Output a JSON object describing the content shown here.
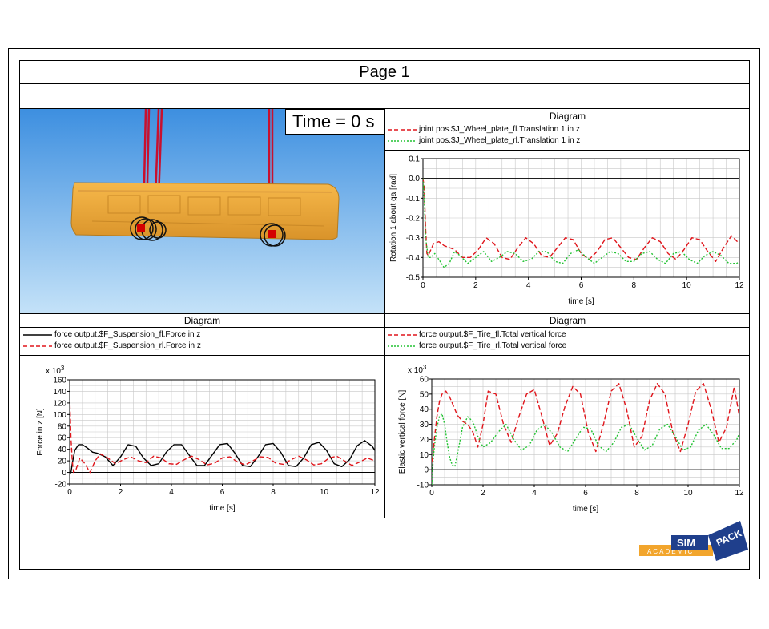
{
  "page": {
    "title": "Page 1"
  },
  "animation": {
    "time_label": "Time = 0 s"
  },
  "logo": {
    "text_top": "SIM",
    "text_right": "PACK",
    "text_bottom": "ACADEMIC"
  },
  "colors": {
    "red": "#e0151b",
    "green": "#22c232",
    "black": "#000000",
    "grid": "#c8c8c8",
    "body": "#f2a52c",
    "sky_top": "#3d8fe0",
    "sky_bottom": "#c4e2f8"
  },
  "chart_data": [
    {
      "id": "chart_rotation",
      "type": "line",
      "panel_title": "Diagram",
      "xlabel": "time [s]",
      "ylabel": "Rotation 1 about ga [rad]",
      "xlim": [
        0,
        12
      ],
      "ylim": [
        -0.5,
        0.1
      ],
      "xticks": [
        0,
        2,
        4,
        6,
        8,
        10,
        12
      ],
      "yticks": [
        -0.5,
        -0.4,
        -0.3,
        -0.2,
        -0.1,
        0.0,
        0.1
      ],
      "ytick_labels": [
        "-0.5",
        "-0.4",
        "-0.3",
        "-0.2",
        "-0.1",
        "0.0",
        "0.1"
      ],
      "multiplier": "",
      "series": [
        {
          "name": "joint pos.$J_Wheel_plate_fl.Translation 1 in z",
          "color": "#e0151b",
          "style": "dashed",
          "x": [
            0,
            0.05,
            0.1,
            0.15,
            0.2,
            0.3,
            0.4,
            0.6,
            0.8,
            1.0,
            1.2,
            1.5,
            1.8,
            2.1,
            2.4,
            2.7,
            3.0,
            3.3,
            3.6,
            3.9,
            4.2,
            4.5,
            4.8,
            5.1,
            5.4,
            5.7,
            6.0,
            6.3,
            6.6,
            6.9,
            7.2,
            7.5,
            7.8,
            8.1,
            8.4,
            8.7,
            9.0,
            9.3,
            9.6,
            9.9,
            10.2,
            10.5,
            10.8,
            11.1,
            11.4,
            11.7,
            12.0
          ],
          "y": [
            0.0,
            -0.05,
            -0.25,
            -0.38,
            -0.39,
            -0.36,
            -0.33,
            -0.32,
            -0.34,
            -0.35,
            -0.36,
            -0.4,
            -0.4,
            -0.36,
            -0.3,
            -0.33,
            -0.4,
            -0.41,
            -0.35,
            -0.3,
            -0.33,
            -0.39,
            -0.4,
            -0.35,
            -0.3,
            -0.31,
            -0.38,
            -0.41,
            -0.37,
            -0.31,
            -0.3,
            -0.35,
            -0.4,
            -0.41,
            -0.35,
            -0.3,
            -0.32,
            -0.38,
            -0.41,
            -0.36,
            -0.3,
            -0.31,
            -0.37,
            -0.42,
            -0.35,
            -0.29,
            -0.33
          ]
        },
        {
          "name": "joint pos.$J_Wheel_plate_rl.Translation 1 in z",
          "color": "#22c232",
          "style": "dotted",
          "x": [
            0,
            0.05,
            0.1,
            0.2,
            0.3,
            0.45,
            0.6,
            0.8,
            1.0,
            1.2,
            1.4,
            1.7,
            2.0,
            2.3,
            2.6,
            2.9,
            3.2,
            3.5,
            3.8,
            4.1,
            4.4,
            4.7,
            5.0,
            5.3,
            5.6,
            5.9,
            6.2,
            6.5,
            6.8,
            7.1,
            7.4,
            7.7,
            8.0,
            8.3,
            8.6,
            8.9,
            9.2,
            9.5,
            9.8,
            10.1,
            10.4,
            10.7,
            11.0,
            11.3,
            11.6,
            11.9,
            12.0
          ],
          "y": [
            0.0,
            -0.1,
            -0.3,
            -0.4,
            -0.4,
            -0.38,
            -0.41,
            -0.45,
            -0.43,
            -0.37,
            -0.39,
            -0.43,
            -0.4,
            -0.37,
            -0.42,
            -0.4,
            -0.37,
            -0.38,
            -0.42,
            -0.41,
            -0.37,
            -0.37,
            -0.42,
            -0.43,
            -0.38,
            -0.36,
            -0.4,
            -0.43,
            -0.4,
            -0.37,
            -0.38,
            -0.42,
            -0.42,
            -0.38,
            -0.37,
            -0.41,
            -0.43,
            -0.38,
            -0.37,
            -0.41,
            -0.43,
            -0.39,
            -0.37,
            -0.39,
            -0.43,
            -0.43,
            -0.42
          ]
        }
      ]
    },
    {
      "id": "chart_suspension",
      "type": "line",
      "panel_title": "Diagram",
      "xlabel": "time [s]",
      "ylabel": "Force in z [N]",
      "xlim": [
        0,
        12
      ],
      "ylim": [
        -20,
        160
      ],
      "xticks": [
        0,
        2,
        4,
        6,
        8,
        10,
        12
      ],
      "yticks": [
        -20,
        0,
        20,
        40,
        60,
        80,
        100,
        120,
        140,
        160
      ],
      "ytick_labels": [
        "-20",
        "0",
        "20",
        "40",
        "60",
        "80",
        "100",
        "120",
        "140",
        "160"
      ],
      "multiplier": "x 10^3",
      "series": [
        {
          "name": "force output.$F_Suspension_fl.Force in z",
          "color": "#000000",
          "style": "solid",
          "x": [
            0,
            0.05,
            0.1,
            0.2,
            0.35,
            0.5,
            0.7,
            0.9,
            1.1,
            1.4,
            1.7,
            2.0,
            2.3,
            2.6,
            2.9,
            3.2,
            3.5,
            3.8,
            4.1,
            4.4,
            4.7,
            5.0,
            5.3,
            5.6,
            5.9,
            6.2,
            6.5,
            6.8,
            7.1,
            7.4,
            7.7,
            8.0,
            8.3,
            8.6,
            8.9,
            9.2,
            9.5,
            9.8,
            10.1,
            10.4,
            10.7,
            11.0,
            11.3,
            11.6,
            11.9,
            12.0
          ],
          "y": [
            -2,
            0,
            15,
            38,
            48,
            48,
            42,
            35,
            33,
            27,
            12,
            27,
            48,
            45,
            25,
            12,
            15,
            35,
            48,
            48,
            30,
            12,
            12,
            30,
            48,
            50,
            33,
            12,
            10,
            27,
            48,
            50,
            35,
            12,
            10,
            25,
            48,
            52,
            38,
            15,
            10,
            22,
            46,
            55,
            45,
            38
          ]
        },
        {
          "name": "force output.$F_Suspension_rl.Force in z",
          "color": "#e0151b",
          "style": "dashed",
          "x": [
            0,
            0.05,
            0.1,
            0.15,
            0.25,
            0.4,
            0.6,
            0.8,
            1.0,
            1.2,
            1.5,
            1.8,
            2.1,
            2.4,
            2.7,
            3.0,
            3.3,
            3.6,
            3.9,
            4.2,
            4.5,
            4.8,
            5.1,
            5.4,
            5.7,
            6.0,
            6.3,
            6.6,
            6.9,
            7.2,
            7.5,
            7.8,
            8.1,
            8.4,
            8.7,
            9.0,
            9.3,
            9.6,
            9.9,
            10.2,
            10.5,
            10.8,
            11.1,
            11.4,
            11.7,
            12.0
          ],
          "y": [
            130,
            60,
            20,
            0,
            5,
            25,
            15,
            0,
            20,
            32,
            25,
            15,
            22,
            27,
            20,
            17,
            28,
            25,
            15,
            14,
            22,
            28,
            22,
            13,
            16,
            25,
            27,
            18,
            13,
            20,
            27,
            26,
            16,
            14,
            22,
            28,
            22,
            13,
            15,
            25,
            28,
            20,
            12,
            18,
            25,
            20
          ]
        }
      ]
    },
    {
      "id": "chart_tire",
      "type": "line",
      "panel_title": "Diagram",
      "xlabel": "time [s]",
      "ylabel": "Elastic vertical force [N]",
      "xlim": [
        0,
        12
      ],
      "ylim": [
        -10,
        60
      ],
      "xticks": [
        0,
        2,
        4,
        6,
        8,
        10,
        12
      ],
      "yticks": [
        -10,
        0,
        10,
        20,
        30,
        40,
        50,
        60
      ],
      "ytick_labels": [
        "-10",
        "0",
        "10",
        "20",
        "30",
        "40",
        "50",
        "60"
      ],
      "multiplier": "x 10^3",
      "series": [
        {
          "name": "force output.$F_Tire_fl.Total vertical force",
          "color": "#e0151b",
          "style": "dashed",
          "x": [
            0,
            0.05,
            0.1,
            0.2,
            0.3,
            0.4,
            0.55,
            0.7,
            0.85,
            1.0,
            1.2,
            1.4,
            1.6,
            1.8,
            2.0,
            2.2,
            2.5,
            2.8,
            3.1,
            3.4,
            3.7,
            4.0,
            4.3,
            4.6,
            4.9,
            5.2,
            5.5,
            5.8,
            6.1,
            6.4,
            6.7,
            7.0,
            7.3,
            7.6,
            7.9,
            8.2,
            8.5,
            8.8,
            9.1,
            9.4,
            9.7,
            10.0,
            10.3,
            10.6,
            10.9,
            11.2,
            11.5,
            11.8,
            12.0
          ],
          "y": [
            5,
            10,
            20,
            35,
            45,
            50,
            52,
            48,
            42,
            36,
            32,
            30,
            25,
            15,
            30,
            52,
            50,
            30,
            18,
            35,
            50,
            53,
            35,
            16,
            24,
            42,
            55,
            50,
            25,
            12,
            30,
            52,
            57,
            40,
            15,
            22,
            46,
            57,
            50,
            25,
            12,
            30,
            52,
            57,
            40,
            18,
            28,
            55,
            35
          ]
        },
        {
          "name": "force output.$F_Tire_rl.Total vertical force",
          "color": "#22c232",
          "style": "dotted",
          "x": [
            0,
            0.05,
            0.1,
            0.2,
            0.3,
            0.4,
            0.5,
            0.6,
            0.7,
            0.8,
            0.9,
            1.0,
            1.2,
            1.4,
            1.6,
            1.8,
            2.0,
            2.3,
            2.6,
            2.9,
            3.2,
            3.5,
            3.8,
            4.1,
            4.4,
            4.7,
            5.0,
            5.3,
            5.6,
            5.9,
            6.2,
            6.5,
            6.8,
            7.1,
            7.4,
            7.7,
            8.0,
            8.3,
            8.6,
            8.9,
            9.2,
            9.5,
            9.8,
            10.1,
            10.4,
            10.7,
            11.0,
            11.3,
            11.6,
            11.9,
            12.0
          ],
          "y": [
            -10,
            5,
            15,
            28,
            35,
            37,
            30,
            18,
            8,
            3,
            2,
            10,
            28,
            35,
            32,
            22,
            15,
            18,
            25,
            30,
            20,
            13,
            16,
            26,
            30,
            24,
            15,
            12,
            20,
            28,
            27,
            16,
            12,
            18,
            28,
            30,
            21,
            13,
            16,
            27,
            30,
            22,
            13,
            15,
            26,
            30,
            23,
            14,
            14,
            20,
            24
          ]
        }
      ]
    }
  ]
}
